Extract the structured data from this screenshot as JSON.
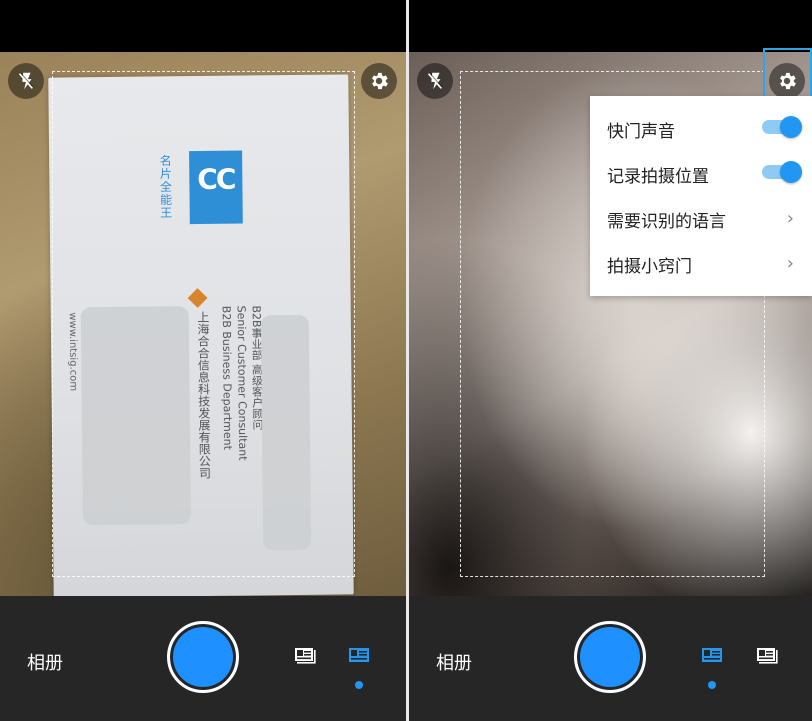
{
  "left_screen": {
    "card": {
      "logo_letters": "CC",
      "logo_caption": "名片全能王",
      "lines": [
        "B2B事业部 高级客户顾问",
        "Senior Customer Consultant",
        "B2B Business Department"
      ],
      "company": "上海合合信息科技发展有限公司",
      "website": "www.intsig.com"
    },
    "bottom_bar": {
      "album_label": "相册"
    }
  },
  "right_screen": {
    "settings_menu": {
      "items": [
        {
          "label": "快门声音",
          "control": "toggle",
          "on": true
        },
        {
          "label": "记录拍摄位置",
          "control": "toggle",
          "on": true
        },
        {
          "label": "需要识别的语言",
          "control": "chevron"
        },
        {
          "label": "拍摄小窍门",
          "control": "chevron"
        }
      ],
      "chevron_glyph": "›"
    },
    "bottom_bar": {
      "album_label": "相册"
    }
  },
  "icons": {
    "flash": "flash-off-icon",
    "settings": "gear-icon",
    "single_card_mode": "single-card-mode-icon",
    "batch_mode": "batch-card-mode-icon"
  },
  "colors": {
    "accent": "#2196f3",
    "bottom_bar": "#262626",
    "highlight": "#2fa4e7"
  }
}
